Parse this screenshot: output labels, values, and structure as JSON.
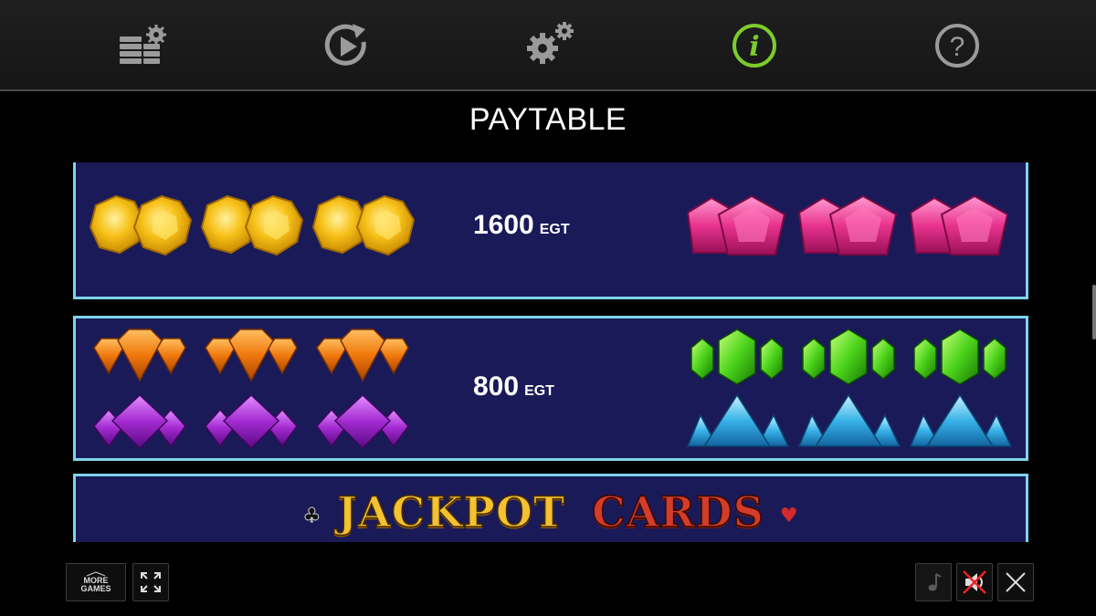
{
  "toolbar": {
    "buttons": [
      {
        "name": "bet-settings",
        "icon": "coin-stack-gear-icon"
      },
      {
        "name": "autoplay",
        "icon": "replay-icon"
      },
      {
        "name": "settings",
        "icon": "gears-icon"
      },
      {
        "name": "info",
        "icon": "info-icon",
        "active": true
      },
      {
        "name": "help",
        "icon": "question-icon"
      }
    ],
    "active_color": "#7ccc2a",
    "icon_color": "#9a9a9a"
  },
  "title": "PAYTABLE",
  "paytable": [
    {
      "payout": "1600",
      "unit": "EGT",
      "left_symbols": [
        "yellow-gem",
        "yellow-gem",
        "yellow-gem"
      ],
      "right_symbols": [
        "pink-gem",
        "pink-gem",
        "pink-gem"
      ]
    },
    {
      "payout": "800",
      "unit": "EGT",
      "left_symbols": [
        "orange-gem",
        "purple-gem"
      ],
      "right_symbols": [
        "green-gem",
        "blue-gem"
      ]
    }
  ],
  "logo": {
    "word1": "JACKPOT",
    "word2": "CARDS"
  },
  "bottom": {
    "more_games_line1": "MORE",
    "more_games_line2": "GAMES"
  },
  "colors": {
    "panel_bg": "#1a1a58",
    "panel_border": "#7fd3ea"
  }
}
